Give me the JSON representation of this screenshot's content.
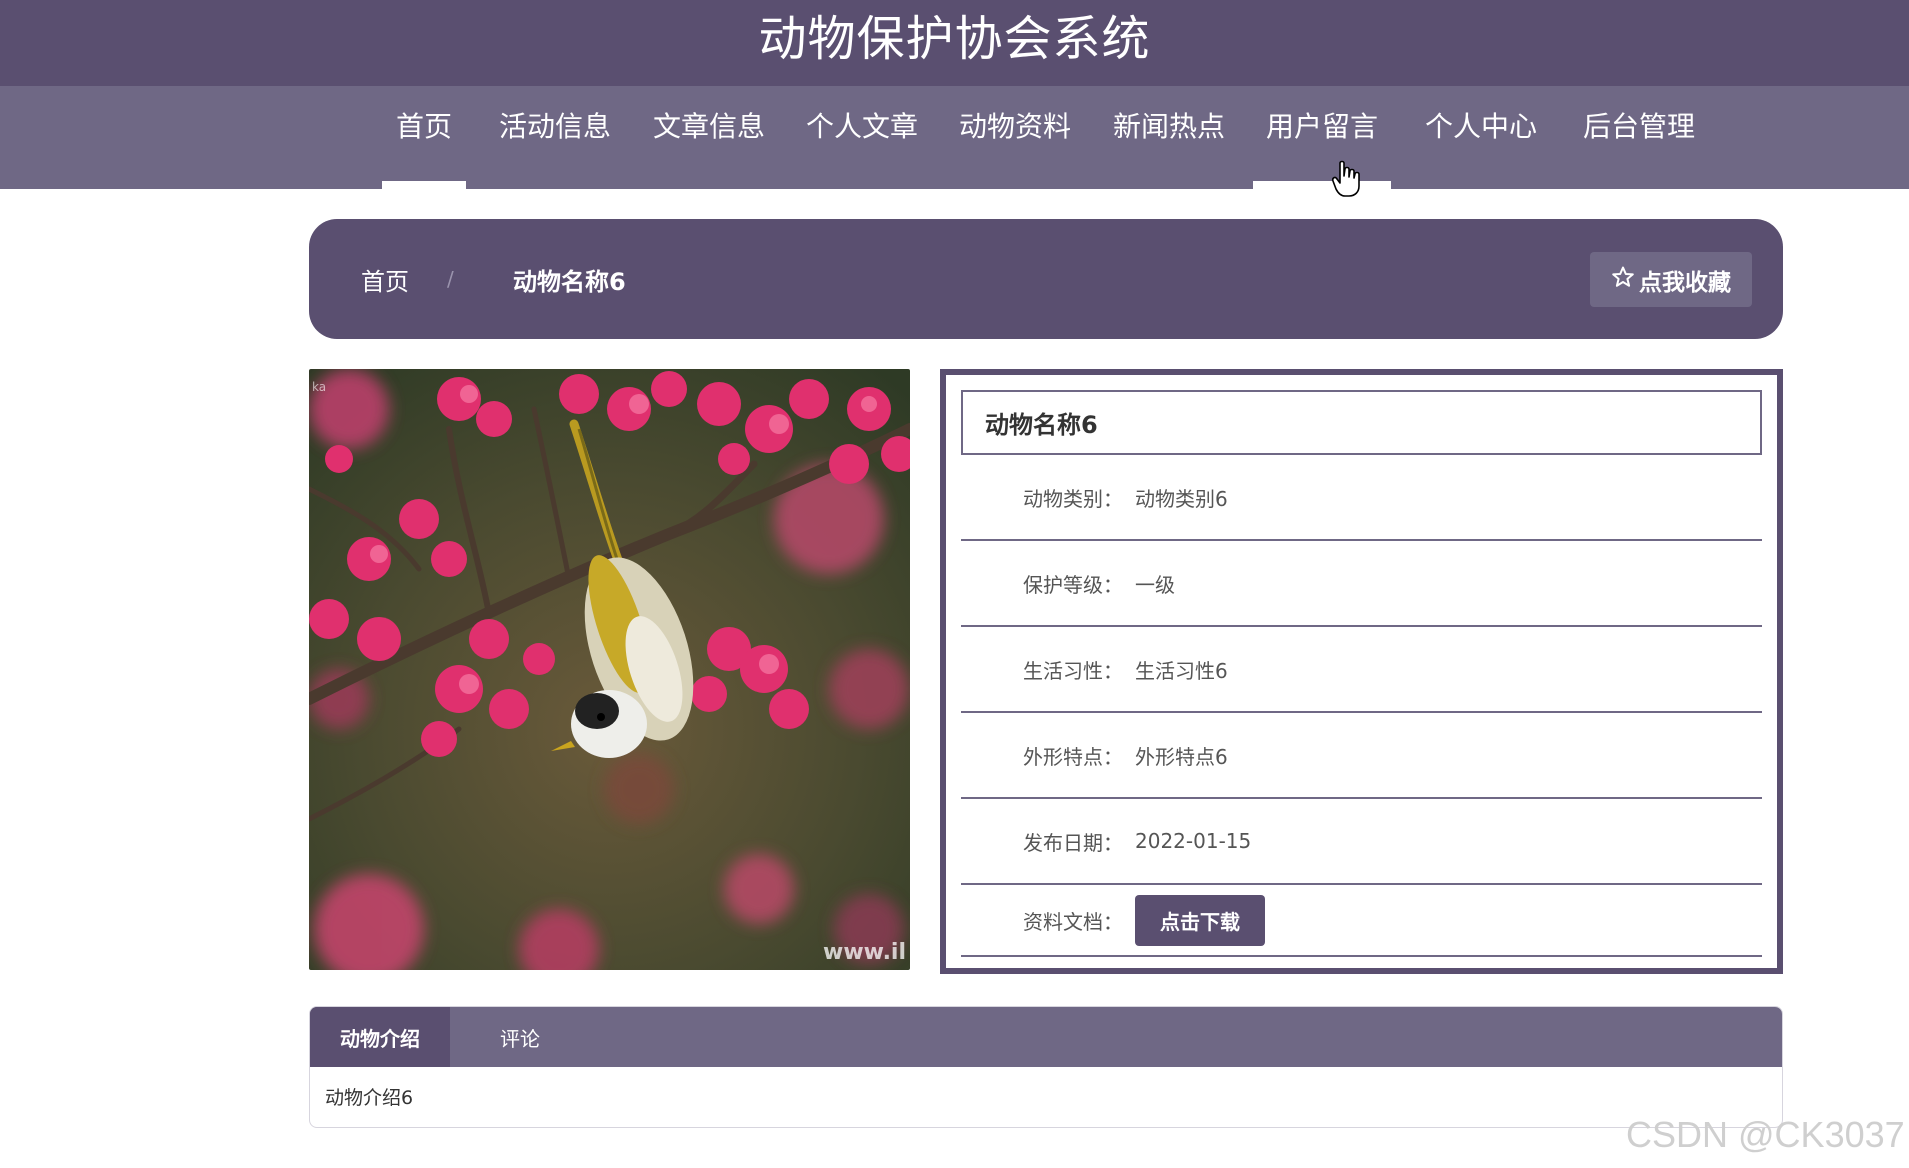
{
  "header": {
    "title": "动物保护协会系统"
  },
  "nav": {
    "items": [
      {
        "label": "首页",
        "state": "active"
      },
      {
        "label": "活动信息"
      },
      {
        "label": "文章信息"
      },
      {
        "label": "个人文章"
      },
      {
        "label": "动物资料"
      },
      {
        "label": "新闻热点"
      },
      {
        "label": "用户留言",
        "state": "hover"
      },
      {
        "label": "个人中心"
      },
      {
        "label": "后台管理"
      }
    ]
  },
  "breadcrumb": {
    "home": "首页",
    "separator": "/",
    "current": "动物名称6",
    "favorite_label": "点我收藏",
    "favorite_icon": "star-outline-icon"
  },
  "photo": {
    "watermark_text": "www.il",
    "corner_text": "ka"
  },
  "details": {
    "title": "动物名称6",
    "rows": [
      {
        "label": "动物类别：",
        "value": "动物类别6"
      },
      {
        "label": "保护等级：",
        "value": "一级"
      },
      {
        "label": "生活习性：",
        "value": "生活习性6"
      },
      {
        "label": "外形特点：",
        "value": "外形特点6"
      },
      {
        "label": "发布日期：",
        "value": "2022-01-15"
      }
    ],
    "document": {
      "label": "资料文档：",
      "button_label": "点击下载"
    }
  },
  "tabs": {
    "items": [
      {
        "label": "动物介绍",
        "state": "active"
      },
      {
        "label": "评论"
      }
    ],
    "content": "动物介绍6"
  },
  "watermark": "CSDN @CK3037",
  "colors": {
    "primary": "#5a4f70",
    "secondary": "#6f6885",
    "white": "#ffffff"
  }
}
